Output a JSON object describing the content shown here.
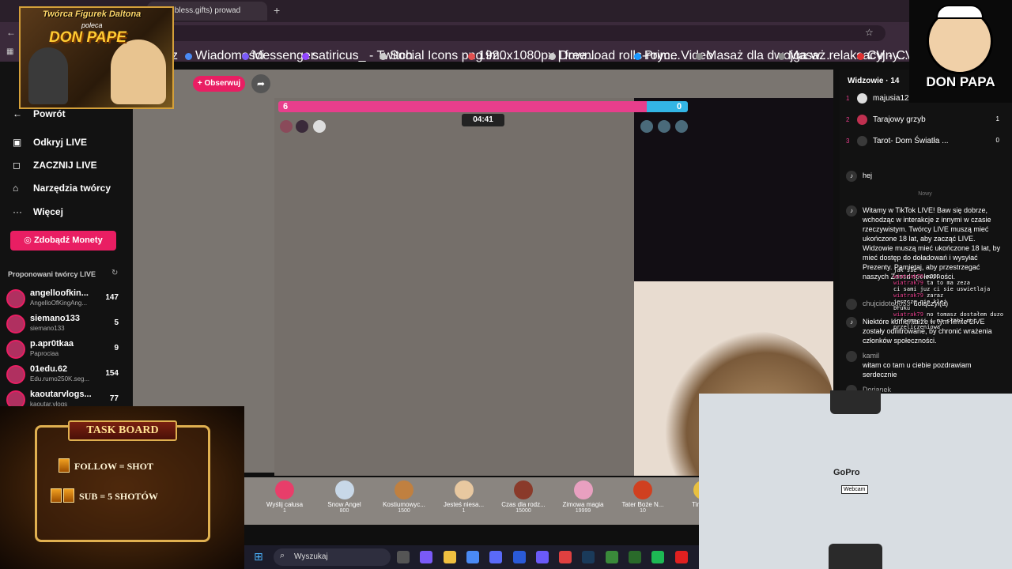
{
  "browser": {
    "tab_title": "mi (@bless.gifts) prowad",
    "new_tab": "+",
    "bookmarks": [
      {
        "label": "cz",
        "color": "#888888"
      },
      {
        "label": "Wiadomości",
        "color": "#4a8af4"
      },
      {
        "label": "Messenger",
        "color": "#7a5af8"
      },
      {
        "label": "satiricus_ - Twitch",
        "color": "#9146ff"
      },
      {
        "label": "Social Icons png im...",
        "color": "#cccccc"
      },
      {
        "label": "1920x1080px | free...",
        "color": "#e05050"
      },
      {
        "label": "Download rolls-royc...",
        "color": "#cccccc"
      },
      {
        "label": "Prime Video",
        "color": "#1a98ff"
      },
      {
        "label": "Masaż dla dwojga w...",
        "color": "#888888"
      },
      {
        "label": "Masaż relaksacyjny...",
        "color": "#888888"
      },
      {
        "label": "CV - CV Maker",
        "color": "#e03030"
      }
    ]
  },
  "overlay": {
    "line1": "Twórca Figurek Daltona",
    "line2": "poleca",
    "line3": "DON PAPE",
    "brand": "DON PAPA"
  },
  "sidebar": {
    "back": "Powrót",
    "items": [
      {
        "label": "Odkryj LIVE",
        "icon": "▣"
      },
      {
        "label": "ZACZNIJ LIVE",
        "icon": "◻"
      },
      {
        "label": "Narzędzia twórcy",
        "icon": "⌂"
      },
      {
        "label": "Więcej",
        "icon": "···"
      }
    ],
    "coins_button": "Zdobądź Monety",
    "suggested_title": "Proponowani twórcy LIVE",
    "creators": [
      {
        "name": "angelloofkin...",
        "sub": "AngelloOfKingAng...",
        "count": "147"
      },
      {
        "name": "siemano133",
        "sub": "siemano133",
        "count": "5"
      },
      {
        "name": "p.apr0tkaa",
        "sub": "Paprociaa",
        "count": "9"
      },
      {
        "name": "01edu.62",
        "sub": "Edu.rumo250K.seg...",
        "count": "154"
      },
      {
        "name": "kaoutarvlogs...",
        "sub": "kaoutar.vlogs",
        "count": "77"
      }
    ]
  },
  "stream": {
    "follow_button": "+ Obserwuj",
    "score_left": "6",
    "score_right": "0",
    "timer": "04:41",
    "battle_left_fraction": 0.9
  },
  "gifts": [
    {
      "name": "Wyślij całusa",
      "price": "1",
      "color": "#e83e6a"
    },
    {
      "name": "Snow Angel",
      "price": "800",
      "color": "#c8d8e8"
    },
    {
      "name": "Kostiumowyc...",
      "price": "1500",
      "color": "#c08040"
    },
    {
      "name": "Jesteś niesa...",
      "price": "1",
      "color": "#e8c8a0"
    },
    {
      "name": "Czas dla rodz...",
      "price": "15000",
      "color": "#8a3a2a"
    },
    {
      "name": "Zimowa magia",
      "price": "19999",
      "color": "#e8a0c0"
    },
    {
      "name": "Tater Boże N...",
      "price": "10",
      "color": "#d04020"
    },
    {
      "name": "Tiny Bo",
      "price": "",
      "color": "#e8c040"
    }
  ],
  "taskbar": {
    "search_placeholder": "Wyszukaj",
    "apps": [
      "#555555",
      "#7a5af8",
      "#f0c040",
      "#4a8af4",
      "#5a6af8",
      "#2a5ad8",
      "#6a5af8",
      "#e04040",
      "#1a3a5a",
      "#3a8a3a",
      "#2a6a2a",
      "#1db954",
      "#e02020"
    ]
  },
  "viewers": {
    "title": "Widzowie · 14",
    "list": [
      {
        "rank": "1",
        "name": "majusia123",
        "score": "",
        "color": "#dddddd"
      },
      {
        "rank": "2",
        "name": "Tarajowy grzyb",
        "score": "1",
        "color": "#c03050"
      },
      {
        "rank": "3",
        "name": "Tarot- Dom Światła ...",
        "score": "0",
        "color": "#3a3a3a"
      }
    ]
  },
  "chat": {
    "separator_new": "Nowy",
    "messages": [
      {
        "user": "",
        "text": "hej"
      },
      {
        "user": "",
        "text": "Witamy w TikTok LIVE! Baw się dobrze, wchodząc w interakcje z innymi w czasie rzeczywistym. Twórcy LIVE muszą mieć ukończone 18 lat, aby zacząć LIVE. Widzowie muszą mieć ukończone 18 lat, by mieć dostęp do doładowań i wysyłać Prezenty. Pamiętaj, aby przestrzegać naszych Zasad społeczności."
      },
      {
        "user": "chujcidotego53",
        "text": "dołączył(a)"
      },
      {
        "user": "",
        "text": "Niektóre komentarze w tym filmie LIVE zostały odfiltrowane, by chronić wrażenia członków społeczności."
      },
      {
        "user": "kamil",
        "text": "witam co tam u ciebie pozdrawiam serdecznie"
      },
      {
        "user": "Dorianek",
        "text": ""
      }
    ]
  },
  "ticker": [
    {
      "user": "",
      "text": "jak sie"
    },
    {
      "user": "wiatrak79",
      "text": "xDDD"
    },
    {
      "user": "wiatrak79",
      "text": "ta to ma zeza"
    },
    {
      "user": "",
      "text": "ci sami juz ci sie uswietlaja"
    },
    {
      "user": "wiatrak79",
      "text": "zaraz"
    },
    {
      "user": "",
      "text": "jeszcze nie klei"
    },
    {
      "user": "",
      "text": "bruku"
    },
    {
      "user": "wiatrak79",
      "text": "no tomasz dostałem duzo informacji i ma słab? moc przeliczeniowa"
    }
  ],
  "taskboard": {
    "title": "TASK BOARD",
    "row1": "FOLLOW = SHOT",
    "row2": "SUB = 5 SHOTÓW"
  },
  "webcam": {
    "logo": "GoPro",
    "label": "Webcam"
  }
}
